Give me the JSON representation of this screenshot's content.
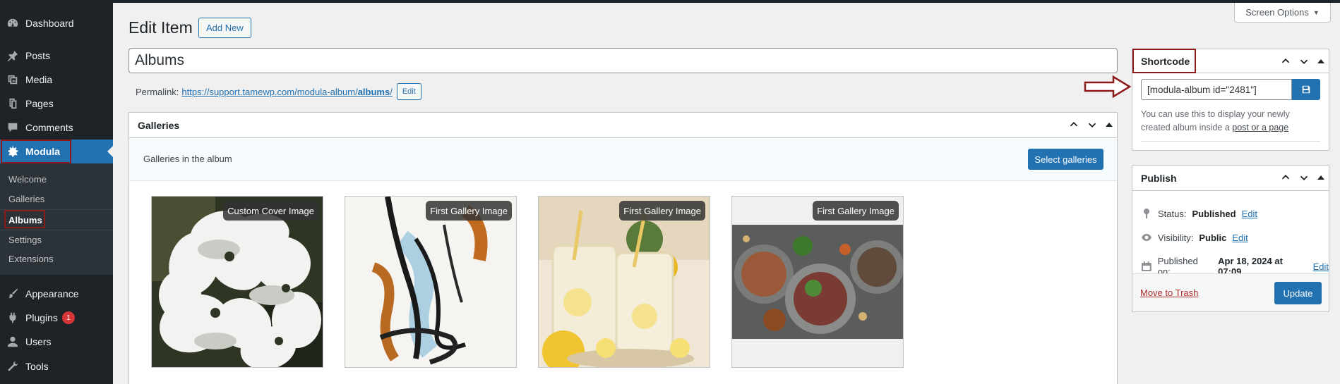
{
  "sidebar": {
    "items": [
      {
        "name": "dashboard",
        "label": "Dashboard",
        "icon": "dashboard-icon"
      },
      {
        "name": "posts",
        "label": "Posts",
        "icon": "pushpin-icon"
      },
      {
        "name": "media",
        "label": "Media",
        "icon": "media-icon"
      },
      {
        "name": "pages",
        "label": "Pages",
        "icon": "pages-icon"
      },
      {
        "name": "comments",
        "label": "Comments",
        "icon": "comment-icon"
      },
      {
        "name": "modula",
        "label": "Modula",
        "icon": "modula-icon"
      },
      {
        "name": "appearance",
        "label": "Appearance",
        "icon": "paintbrush-icon"
      },
      {
        "name": "plugins",
        "label": "Plugins",
        "icon": "plugin-icon",
        "badge": "1"
      },
      {
        "name": "users",
        "label": "Users",
        "icon": "users-icon"
      },
      {
        "name": "tools",
        "label": "Tools",
        "icon": "wrench-icon"
      }
    ],
    "submenu": [
      "Welcome",
      "Galleries",
      "Albums",
      "Settings",
      "Extensions"
    ]
  },
  "header": {
    "title": "Edit Item",
    "add_new": "Add New",
    "screen_options": "Screen Options"
  },
  "post": {
    "title": "Albums",
    "permalink_label": "Permalink:",
    "permalink_base": "https://support.tamewp.com/modula-album/",
    "permalink_slug": "albums",
    "permalink_trail": "/",
    "permalink_edit": "Edit"
  },
  "galleries": {
    "heading": "Galleries",
    "toolbar_text": "Galleries in the album",
    "select_button": "Select galleries",
    "items": [
      {
        "tag": "Custom Cover Image"
      },
      {
        "tag": "First Gallery Image"
      },
      {
        "tag": "First Gallery Image"
      },
      {
        "tag": "First Gallery Image"
      }
    ]
  },
  "shortcode": {
    "heading": "Shortcode",
    "value": "[modula-album id=\"2481\"]",
    "help": "You can use this to display your newly created album inside a",
    "help_link": "post or a page"
  },
  "publish": {
    "heading": "Publish",
    "status_label": "Status:",
    "status_value": "Published",
    "visibility_label": "Visibility:",
    "visibility_value": "Public",
    "published_label": "Published on:",
    "published_value": "Apr 18, 2024 at 07:09",
    "edit": "Edit",
    "trash": "Move to Trash",
    "update": "Update"
  },
  "colors": {
    "accent": "#2271b1",
    "sidebar": "#1d2327",
    "highlight_outline": "#8b1a1a"
  }
}
